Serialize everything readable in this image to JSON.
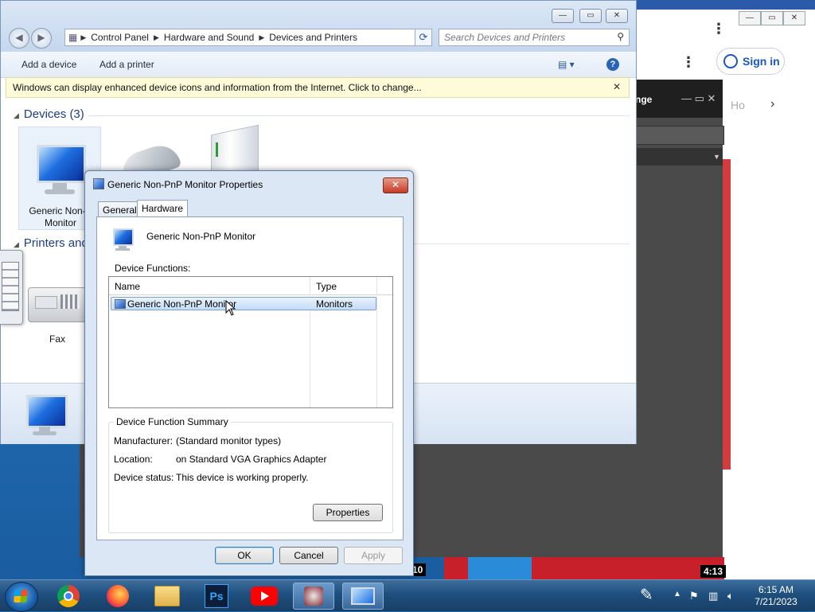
{
  "explorer": {
    "breadcrumb": [
      "Control Panel",
      "Hardware and Sound",
      "Devices and Printers"
    ],
    "search_placeholder": "Search Devices and Printers",
    "toolbar": {
      "add_device": "Add a device",
      "add_printer": "Add a printer"
    },
    "infobar_text": "Windows can display enhanced device icons and information from the Internet. Click to change...",
    "devices_header": "Devices (3)",
    "printers_header": "Printers and",
    "devices": [
      {
        "label_line1": "Generic Non-P",
        "label_line2": "Monitor",
        "icon": "monitor-icon"
      },
      {
        "icon": "mouse-icon"
      },
      {
        "icon": "drive-icon"
      }
    ],
    "printers": [
      {
        "label": "Fax",
        "icon": "fax-icon"
      }
    ]
  },
  "browser": {
    "sign_in": "Sign in",
    "partial_text_1": "nge",
    "partial_text_2": "Ho",
    "badge_left": "10",
    "badge_right": "4:13"
  },
  "dialog": {
    "title": "Generic Non-PnP Monitor Properties",
    "tabs": [
      "General",
      "Hardware"
    ],
    "active_tab": "Hardware",
    "device_name": "Generic Non-PnP Monitor",
    "functions_label": "Device Functions:",
    "columns": [
      "Name",
      "Type"
    ],
    "rows": [
      {
        "name": "Generic Non-PnP Monitor",
        "type": "Monitors"
      }
    ],
    "summary_label": "Device Function Summary",
    "summary": [
      {
        "key": "Manufacturer:",
        "value": "(Standard monitor types)"
      },
      {
        "key": "Location:",
        "value": "on Standard VGA Graphics Adapter"
      },
      {
        "key": "Device status:",
        "value": "This device is working properly."
      }
    ],
    "properties_button": "Properties",
    "ok_button": "OK",
    "cancel_button": "Cancel",
    "apply_button": "Apply"
  },
  "taskbar": {
    "time": "6:15 AM",
    "date": "7/21/2023",
    "ps_label": "Ps",
    "apps": [
      "chrome-icon",
      "firefox-icon",
      "file-explorer-icon",
      "photoshop-icon",
      "youtube-icon",
      "app-icon",
      "devices-printers-icon"
    ]
  },
  "colors": {
    "accent": "#1e3c8a",
    "taskbar": "#1f4f7e",
    "close_red": "#c33b25"
  }
}
